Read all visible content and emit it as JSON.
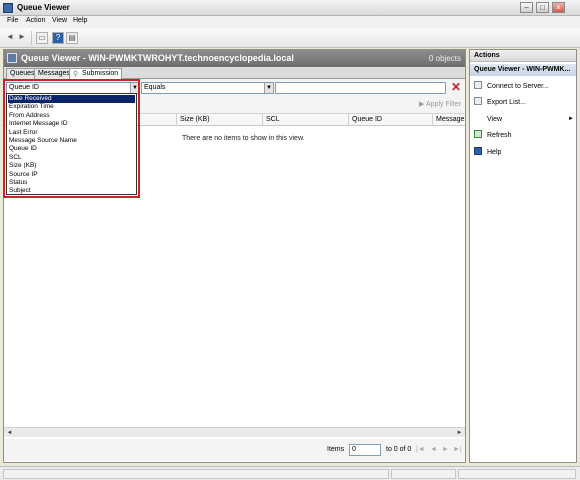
{
  "window": {
    "title": "Queue Viewer"
  },
  "menu": [
    "File",
    "Action",
    "View",
    "Help"
  ],
  "panel": {
    "title": "Queue Viewer - WIN-PWMKTWROHYT.technoencyclopedia.local",
    "count": "0 objects",
    "tabs": [
      "Queues",
      "Messages",
      "Submission"
    ]
  },
  "filter": {
    "field_value": "Queue ID",
    "operator_value": "Equals",
    "criteria_value": "",
    "apply_label": "Apply Filter"
  },
  "grid": {
    "columns": [
      "Size (KB)",
      "SCL",
      "Queue ID",
      "Message S"
    ],
    "empty_message": "There are no items to show in this view."
  },
  "dropdown": {
    "selected_index": 0,
    "options": [
      "Date Received",
      "Expiration Time",
      "From Address",
      "Internet Message ID",
      "Last Error",
      "Message Source Name",
      "Queue ID",
      "SCL",
      "Size (KB)",
      "Source IP",
      "Status",
      "Subject"
    ]
  },
  "pager": {
    "label": "Items",
    "value": "0",
    "total": "to 0 of 0",
    "buttons": [
      "|◄",
      "◄",
      "►",
      "►|"
    ]
  },
  "actions": {
    "header": "Actions",
    "section": "Queue Viewer - WIN-PWMK...",
    "items": [
      "Connect to Server...",
      "Export List...",
      "View",
      "Refresh",
      "Help"
    ]
  },
  "colors": {
    "highlight": "#d0202a",
    "selection": "#0a246a",
    "delete": "#c0272d"
  }
}
